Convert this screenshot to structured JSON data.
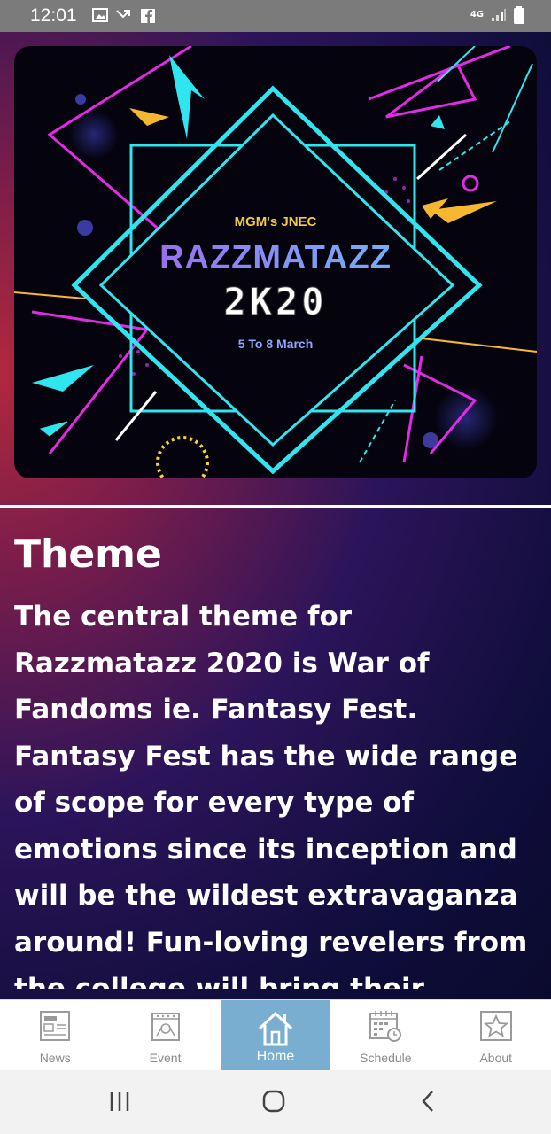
{
  "status_bar": {
    "time": "12:01",
    "network": "4G"
  },
  "banner": {
    "organizer": "MGM's JNEC",
    "fest_name": "RAZZMATAZZ",
    "year": "2K20",
    "dates": "5 To 8 March"
  },
  "theme": {
    "title": "Theme",
    "body": "The central theme for Razzmatazz 2020 is War of Fandoms ie.  Fantasy Fest. Fantasy Fest has the wide range of scope for every type of emotions since its inception and will be the wildest extravaganza around! Fun-loving revelers from the college will bring their creativity and imaginations as they descend"
  },
  "bottom_nav": {
    "items": [
      {
        "label": "News",
        "icon": "newspaper-icon"
      },
      {
        "label": "Event",
        "icon": "event-icon"
      },
      {
        "label": "Home",
        "icon": "home-icon",
        "active": true
      },
      {
        "label": "Schedule",
        "icon": "calendar-icon"
      },
      {
        "label": "About",
        "icon": "star-icon"
      }
    ]
  },
  "colors": {
    "nav_active": "#7aaed0",
    "accent_cyan": "#2fe6f0",
    "accent_magenta": "#e629e6"
  }
}
